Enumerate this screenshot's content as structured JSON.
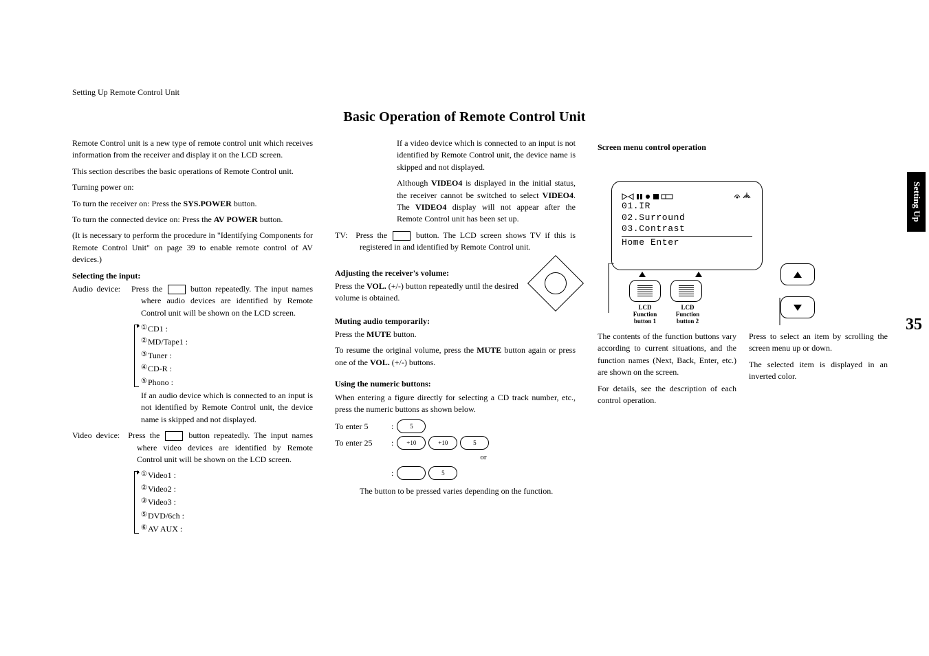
{
  "running_header": "Setting Up Remote Control Unit",
  "main_title": "Basic Operation of Remote Control Unit",
  "side_tab": "Setting Up",
  "page_number": "35",
  "col1": {
    "intro1": "Remote Control unit is a new type of remote control unit which receives information from the receiver and display it on the LCD screen.",
    "intro2": "This section describes the basic operations of Remote Control unit.",
    "turning_power_on": "Turning power on:",
    "turn_receiver": "To turn the receiver on: Press the ",
    "turn_receiver_btn": "SYS.POWER",
    "turn_receiver_after": " button.",
    "turn_device": "To turn the connected device on: Press the ",
    "turn_device_btn": "AV POWER",
    "turn_device_after": " button.",
    "turn_note": "(It is necessary to perform the procedure in \"Identifying Components for Remote Control Unit\" on page 39 to enable remote control of AV devices.)",
    "selecting_input_heading": "Selecting the input:",
    "audio_label": "Audio device:",
    "audio_text1": "Press the ",
    "audio_text2": " button repeatedly. The input names where audio devices are identified by Remote Control unit will be shown on the LCD screen.",
    "audio_items": [
      "CD1 :",
      "MD/Tape1 :",
      "Tuner :",
      "CD-R :",
      "Phono :"
    ],
    "audio_numbers": [
      "①",
      "②",
      "③",
      "④",
      "⑤"
    ],
    "audio_note": "If an audio device which is connected to an input is not identified by Remote Control unit, the device name is skipped and not displayed.",
    "video_label": "Video device:",
    "video_text1": "Press the ",
    "video_text2": " button repeatedly. The input names where video devices are identified by Remote Control unit will be shown on the LCD screen.",
    "video_items": [
      "Video1 :",
      "Video2 :",
      "Video3 :",
      "DVD/6ch :",
      "AV AUX :"
    ],
    "video_numbers": [
      "①",
      "②",
      "③",
      "⑤",
      "⑥"
    ]
  },
  "col2": {
    "video_device_note": "If a video device which is connected to an input is not identified by Remote Control unit, the device name is skipped and not displayed.",
    "video4_note_1": "Although ",
    "video4_note_bold1": "VIDEO4",
    "video4_note_2": " is displayed in the initial status, the receiver cannot be switched to select ",
    "video4_note_bold2": "VIDEO4",
    "video4_note_3": ". The ",
    "video4_note_bold3": "VIDEO4",
    "video4_note_4": " display will not appear after the Remote Control unit has been set up.",
    "tv_label": "TV:",
    "tv_text1": "Press the ",
    "tv_text2": " button. The LCD screen shows TV if this is registered in and identified by Remote Control unit.",
    "adjust_heading": "Adjusting the receiver's volume:",
    "adjust_text1": "Press the ",
    "adjust_vol": "VOL.",
    "adjust_text2": " (+/-) button repeatedly until the desired volume is obtained.",
    "muting_heading": "Muting audio temporarily:",
    "muting_text1": "Press the ",
    "muting_mute": "MUTE",
    "muting_text2": " button.",
    "muting_text3a": "To resume the original volume, press the ",
    "muting_text3b": " button again or press one of the ",
    "muting_text3c": " (+/-) buttons.",
    "numeric_heading": "Using the numeric buttons:",
    "numeric_text": "When entering a figure directly for selecting a CD track number, etc., press the numeric buttons as shown below.",
    "enter5_label": "To enter 5",
    "enter25_label": "To enter 25",
    "colon": ":",
    "or_text": "or",
    "numeric_note": "The button to be pressed varies depending on the function.",
    "pill_5": "5",
    "pill_10": "+10"
  },
  "col3": {
    "screen_menu_heading": "Screen menu control operation",
    "lcd_lines": [
      "01.IR",
      "02.Surround",
      "03.Contrast",
      "Home  Enter"
    ],
    "fn1_label": "LCD Function button 1",
    "fn2_label": "LCD Function button 2",
    "left_text": "The contents of the function buttons vary according to current situations, and the function names (Next, Back, Enter, etc.) are shown on the screen.",
    "left_text2": "For details, see the description of each control operation.",
    "right_text1": "Press to select an item by scrolling the screen menu up or down.",
    "right_text2": "The selected item is displayed in an inverted color."
  }
}
